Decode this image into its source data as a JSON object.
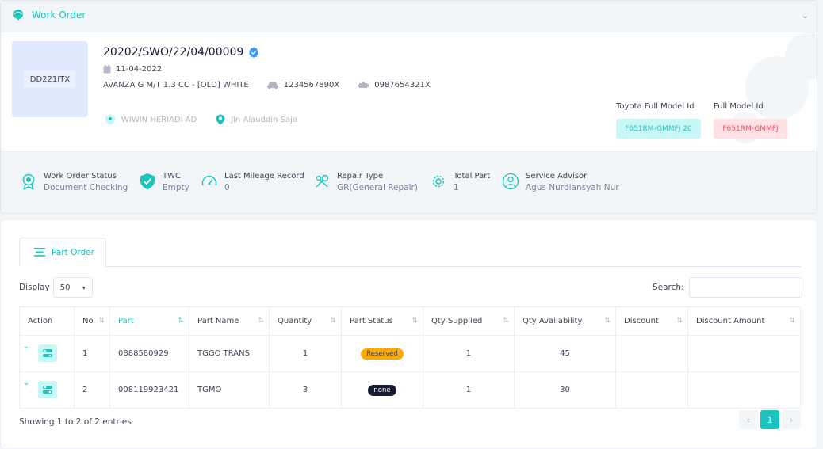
{
  "header": {
    "title": "Work Order"
  },
  "vehicle": {
    "plate": "DD221ITX",
    "wo_number": "20202/SWO/22/04/00009",
    "date": "11-04-2022",
    "model": "AVANZA G M/T 1.3 CC - [OLD] WHITE",
    "engine_no": "1234567890X",
    "chassis_no": "0987654321X",
    "customer": "WIWIN HERIADI AD",
    "address": "Jln Alauddin Saja",
    "toyota_full_model_label": "Toyota Full Model Id",
    "toyota_full_model_value": "F651RM-GMMFJ 20",
    "full_model_label": "Full Model Id",
    "full_model_value": "F651RM-GMMFJ"
  },
  "stats": [
    {
      "label": "Work Order Status",
      "value": "Document Checking",
      "icon": "badge-icon"
    },
    {
      "label": "TWC",
      "value": "Empty",
      "icon": "shield-check-icon"
    },
    {
      "label": "Last Mileage Record",
      "value": "0",
      "icon": "speedometer-icon"
    },
    {
      "label": "Repair Type",
      "value": "GR(General Repair)",
      "icon": "tools-icon"
    },
    {
      "label": "Total Part",
      "value": "1",
      "icon": "gear-icon"
    },
    {
      "label": "Service Advisor",
      "value": "Agus Nurdiansyah Nur",
      "icon": "user-icon"
    }
  ],
  "tab": {
    "label": "Part Order"
  },
  "table_controls": {
    "display_label": "Display",
    "page_size": "50",
    "search_label": "Search:"
  },
  "table": {
    "headers": [
      "Action",
      "No",
      "Part",
      "Part Name",
      "Quantity",
      "Part Status",
      "Qty Supplied",
      "Qty Availability",
      "Discount",
      "Discount Amount"
    ],
    "rows": [
      {
        "no": "1",
        "part": "0888580929",
        "part_name": "TGGO TRANS",
        "quantity": "1",
        "status": "Reserved",
        "qty_supplied": "1",
        "qty_availability": "45",
        "discount": "",
        "discount_amount": ""
      },
      {
        "no": "2",
        "part": "008119923421",
        "part_name": "TGMO",
        "quantity": "3",
        "status": "none",
        "qty_supplied": "1",
        "qty_availability": "30",
        "discount": "",
        "discount_amount": ""
      }
    ]
  },
  "footer": {
    "showing": "Showing 1 to 2 of 2 entries",
    "current_page": "1",
    "prev": "‹",
    "next": "›"
  },
  "colors": {
    "accent": "#1bc5bd",
    "danger": "#f64e60",
    "warning": "#ffa800"
  }
}
